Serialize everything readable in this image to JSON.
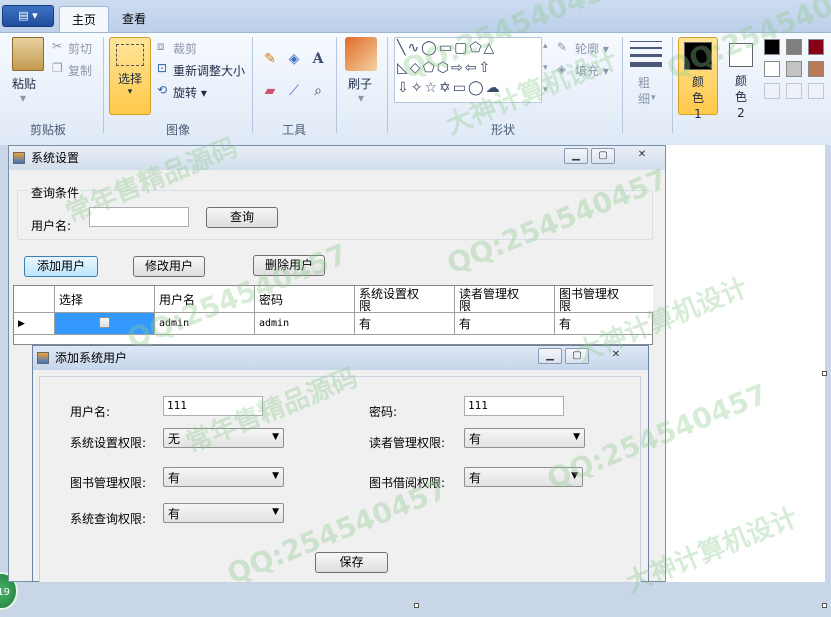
{
  "ribbon": {
    "app_menu_label": "▤ ▾",
    "tabs": [
      {
        "label": "主页"
      },
      {
        "label": "查看"
      }
    ],
    "clipboard": {
      "paste": "粘贴",
      "cut": "剪切",
      "copy": "复制",
      "group": "剪贴板"
    },
    "image": {
      "select": "选择",
      "crop": "裁剪",
      "resize": "重新调整大小",
      "rotate": "旋转",
      "group": "图像"
    },
    "tools": {
      "group": "工具",
      "text_tool": "A"
    },
    "brushes": {
      "label": "刷子"
    },
    "shapes": {
      "outline": "轮廓",
      "fill": "填充",
      "group": "形状"
    },
    "size": {
      "label": "粗细"
    },
    "colors": {
      "color1": "颜色 1",
      "color2": "颜色 2",
      "color1_hex": "#000000",
      "color2_hex": "#ffffff",
      "palette": [
        "#000000",
        "#7f7f7f",
        "#880015",
        "#ffffff",
        "#c3c3c3",
        "#b97a57"
      ]
    }
  },
  "sys_window": {
    "title": "系统设置",
    "query_group": "查询条件",
    "username_label": "用户名:",
    "username_value": "",
    "query_button": "查询",
    "add_button": "添加用户",
    "edit_button": "修改用户",
    "delete_button": "删除用户",
    "grid": {
      "columns": [
        "选择",
        "用户名",
        "密码",
        "系统设置权限",
        "读者管理权限",
        "图书管理权限"
      ],
      "rows": [
        {
          "username": "admin",
          "password": "admin",
          "sys": "有",
          "reader": "有",
          "book": "有"
        }
      ]
    }
  },
  "add_window": {
    "title": "添加系统用户",
    "username_label": "用户名:",
    "username_value": "111",
    "password_label": "密码:",
    "password_value": "111",
    "sys_perm_label": "系统设置权限:",
    "sys_perm_value": "无",
    "reader_perm_label": "读者管理权限:",
    "reader_perm_value": "有",
    "book_perm_label": "图书管理权限:",
    "book_perm_value": "有",
    "borrow_perm_label": "图书借阅权限:",
    "borrow_perm_value": "有",
    "query_perm_label": "系统查询权限:",
    "query_perm_value": "有",
    "save_button": "保存"
  },
  "watermarks": [
    "QQ:254540457",
    "大神计算机设计",
    "常年售精品源码"
  ]
}
